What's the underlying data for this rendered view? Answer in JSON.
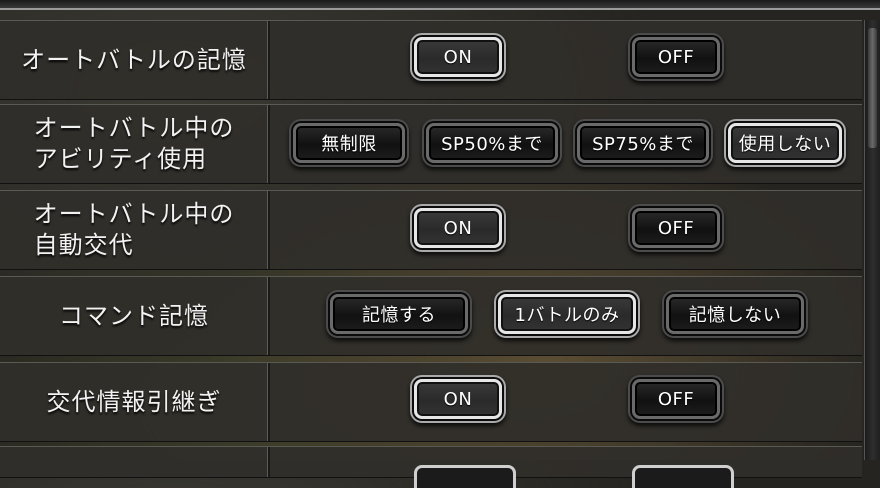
{
  "settings": [
    {
      "label": "オートバトルの記憶",
      "options": [
        "ON",
        "OFF"
      ],
      "selected": 0
    },
    {
      "label": "オートバトル中の\nアビリティ使用",
      "options": [
        "無制限",
        "SP50%まで",
        "SP75%まで",
        "使用しない"
      ],
      "selected": 3
    },
    {
      "label": "オートバトル中の\n自動交代",
      "options": [
        "ON",
        "OFF"
      ],
      "selected": 0
    },
    {
      "label": "コマンド記憶",
      "options": [
        "記憶する",
        "1バトルのみ",
        "記憶しない"
      ],
      "selected": 1
    },
    {
      "label": "交代情報引継ぎ",
      "options": [
        "ON",
        "OFF"
      ],
      "selected": 0
    },
    {
      "label": "",
      "options": [
        "",
        ""
      ],
      "selected": 0
    }
  ],
  "background": {
    "scene": "pixel-art battle field with party characters, dimmed"
  },
  "colors": {
    "panel": "#302e2a",
    "button_border_selected": "#e6e6e6",
    "button_border_unselected": "#6a6a6a",
    "text": "#ffffff"
  }
}
